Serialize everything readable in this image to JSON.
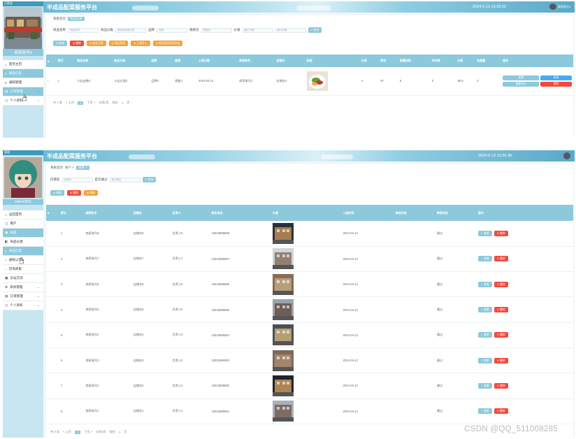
{
  "app_title": "半成品配菜服务平台",
  "watermark": "CSDN @QQ_511008285",
  "panel1": {
    "sidebar_top": "已登录",
    "nick": "商家账号4",
    "datetime": "2024-5-13 13:28:52",
    "user_label": "商家账号4",
    "menu": [
      {
        "icon": "home-icon",
        "label": "首页主页",
        "active": false
      },
      {
        "icon": "list-icon",
        "label": "商品信息",
        "active": true
      },
      {
        "icon": "list-icon",
        "label": "通知管理",
        "active": false
      },
      {
        "icon": "order-icon",
        "label": "订单管理",
        "active": true,
        "chev": true
      },
      {
        "icon": "user-icon",
        "label": "个人资料",
        "active": false,
        "chev": true
      }
    ],
    "crumb": [
      "系统首页",
      "商品信息"
    ],
    "filters": [
      {
        "label": "商品名称",
        "ph": "商品名称"
      },
      {
        "label": "商品分类",
        "ph": "请选择商品分类"
      },
      {
        "label": "品牌",
        "ph": "品牌"
      },
      {
        "label": "规格包",
        "ph": "规格包"
      },
      {
        "label": "价格",
        "ph": "最小价格"
      },
      {
        "label": "",
        "ph": "最大价格"
      }
    ],
    "search_btn": "查询",
    "actions": [
      "新增",
      "删除",
      "商品分类",
      "商品报表",
      "上架导入",
      "商品相关信息导出"
    ],
    "columns": [
      "索引",
      "商品名称",
      "商品分类",
      "品牌",
      "规格",
      "上架日期",
      "商家账号",
      "店铺名",
      "封面",
      "价格",
      "库存",
      "限量抢购",
      "评论数",
      "价格",
      "收藏量",
      "操作"
    ],
    "row": {
      "idx": "1",
      "name": "小店出售4",
      "category": "小店分类4",
      "brand": "品牌4",
      "spec": "规格4",
      "date": "2024-04-12",
      "merchant": "商家账号4",
      "shop": "店铺名4",
      "price": "4",
      "stock": "97",
      "limit": "9",
      "comments": "0",
      "price2": "95.9",
      "fav": "0"
    },
    "row_btns": [
      "查看",
      "修改",
      "查看评论",
      "删除"
    ],
    "pager": {
      "total": "共 1 条",
      "prev": "< 上页",
      "page": "1",
      "next": "下页 >",
      "size": "10条/页",
      "goto": "前往",
      "goto_page": "1",
      "unit": "页"
    }
  },
  "panel2": {
    "sidebar_top": "管理",
    "nick": "admin001",
    "datetime": "2024-5-13 13:29:38",
    "menu": [
      {
        "icon": "home-icon",
        "label": "返回首页",
        "active": false
      },
      {
        "icon": "user-icon",
        "label": "用户",
        "active": false
      },
      {
        "icon": "shop-icon",
        "label": "商家",
        "active": true
      },
      {
        "icon": "store-icon",
        "label": "商品分类",
        "active": false
      },
      {
        "icon": "list-icon",
        "label": "商品信息",
        "active": true
      },
      {
        "icon": "bell-icon",
        "label": "通知公告",
        "active": false
      },
      {
        "icon": "chat-icon",
        "label": "咨询商家",
        "active": false
      },
      {
        "icon": "forum-icon",
        "label": "论坛交流",
        "active": false
      },
      {
        "icon": "sys-icon",
        "label": "系统管理",
        "active": false,
        "chev": true
      },
      {
        "icon": "order-icon",
        "label": "订单管理",
        "active": false,
        "chev": true
      },
      {
        "icon": "user-icon",
        "label": "个人资料",
        "active": false,
        "chev": true
      }
    ],
    "crumb": [
      "系统首页",
      "商户 ×",
      "商家 ×"
    ],
    "filters": [
      {
        "label": "店铺名",
        "ph": "店铺名"
      },
      {
        "label": "是否通过",
        "ph": "是否通过"
      }
    ],
    "search_btn": "查询",
    "actions": [
      "新增",
      "删除",
      "审核"
    ],
    "columns": [
      "索引",
      "商家账号",
      "店铺名",
      "负责人",
      "联系电话",
      "头像",
      "入驻时间",
      "审核状态",
      "审核状态",
      "操作"
    ],
    "rows": [
      {
        "idx": "1",
        "acct": "商家账号8",
        "shop": "店铺名8",
        "owner": "负责人8",
        "phone": "13823888888",
        "date": "2024-04-12",
        "status": "通过"
      },
      {
        "idx": "2",
        "acct": "商家账号7",
        "shop": "店铺名7",
        "owner": "负责人7",
        "phone": "13823888887",
        "date": "2024-04-12",
        "status": "通过"
      },
      {
        "idx": "3",
        "acct": "商家账号6",
        "shop": "店铺名6",
        "owner": "负责人6",
        "phone": "13823888886",
        "date": "2024-04-12",
        "status": "通过"
      },
      {
        "idx": "4",
        "acct": "商家账号5",
        "shop": "店铺名5",
        "owner": "负责人5",
        "phone": "13823888885",
        "date": "2024-04-12",
        "status": "通过"
      },
      {
        "idx": "5",
        "acct": "商家账号4",
        "shop": "店铺名4",
        "owner": "负责人4",
        "phone": "13823888884",
        "date": "2024-04-12",
        "status": "通过"
      },
      {
        "idx": "6",
        "acct": "商家账号3",
        "shop": "店铺名3",
        "owner": "负责人3",
        "phone": "13823888883",
        "date": "2024-04-12",
        "status": "通过"
      },
      {
        "idx": "7",
        "acct": "商家账号2",
        "shop": "店铺名2",
        "owner": "负责人2",
        "phone": "13823888882",
        "date": "2024-04-12",
        "status": "通过"
      },
      {
        "idx": "8",
        "acct": "商家账号1",
        "shop": "店铺名1",
        "owner": "负责人1",
        "phone": "13823888881",
        "date": "2024-04-12",
        "status": "通过"
      }
    ],
    "row_btns": [
      "查看",
      "删除"
    ],
    "pager": {
      "total": "共 8 条",
      "prev": "< 上页",
      "page": "1",
      "next": "下页 >",
      "size": "10条/页",
      "goto": "前往",
      "goto_page": "1",
      "unit": "页"
    }
  }
}
